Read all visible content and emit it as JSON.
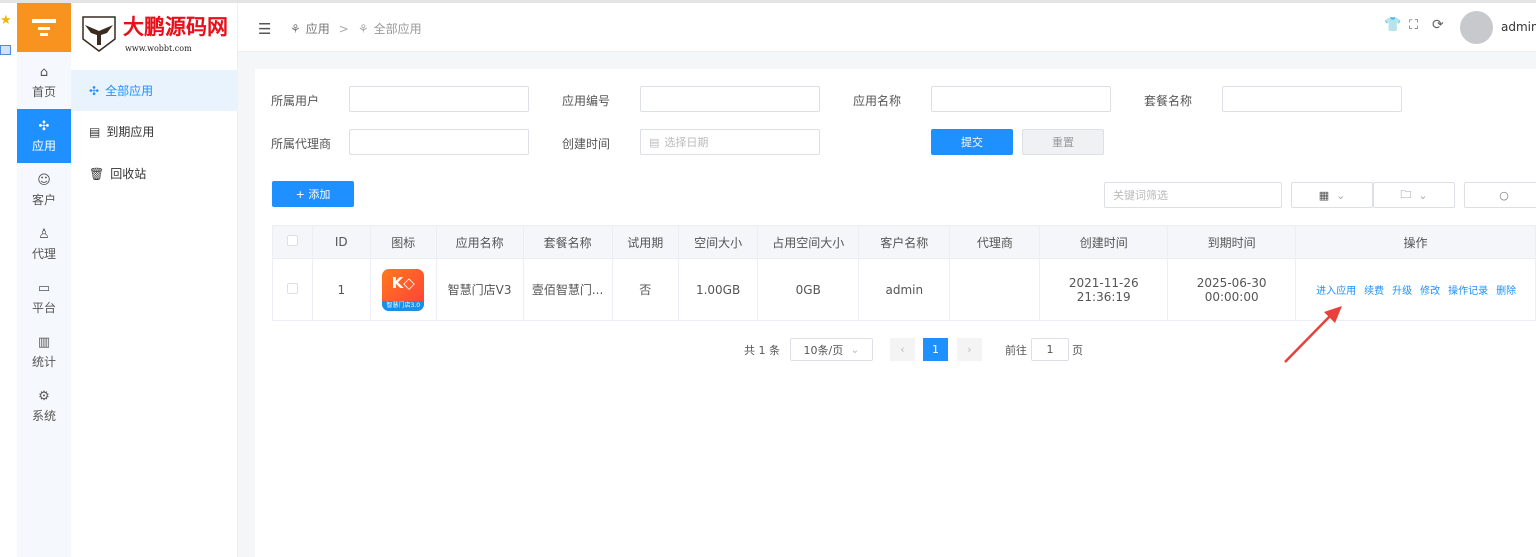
{
  "brand": {
    "name": "大鹏源码网",
    "url": "www.wobbt.com"
  },
  "rail": [
    {
      "label": "首页",
      "icon": "home-icon"
    },
    {
      "label": "应用",
      "icon": "apps-icon",
      "active": true
    },
    {
      "label": "客户",
      "icon": "user-icon"
    },
    {
      "label": "代理",
      "icon": "agent-icon"
    },
    {
      "label": "平台",
      "icon": "monitor-icon"
    },
    {
      "label": "统计",
      "icon": "chart-icon"
    },
    {
      "label": "系统",
      "icon": "gear-icon"
    }
  ],
  "submenu": [
    {
      "label": "全部应用",
      "active": true
    },
    {
      "label": "到期应用"
    },
    {
      "label": "回收站"
    }
  ],
  "breadcrumb": {
    "parent": "应用",
    "sep": ">",
    "current": "全部应用"
  },
  "header": {
    "user": "admin"
  },
  "filters": {
    "owner_user": "所属用户",
    "app_no": "应用编号",
    "app_name": "应用名称",
    "package_name": "套餐名称",
    "agent": "所属代理商",
    "created": "创建时间",
    "date_placeholder": "选择日期",
    "submit": "提交",
    "reset": "重置"
  },
  "toolbar": {
    "add": "+ 添加",
    "keyword_placeholder": "关键词筛选"
  },
  "table": {
    "headers": [
      "ID",
      "图标",
      "应用名称",
      "套餐名称",
      "试用期",
      "空间大小",
      "占用空间大小",
      "客户名称",
      "代理商",
      "创建时间",
      "到期时间",
      "操作"
    ],
    "rows": [
      {
        "id": "1",
        "icon_text": "智慧门店3.0",
        "app_name": "智慧门店V3",
        "package": "壹佰智慧门...",
        "trial": "否",
        "space": "1.00GB",
        "used": "0GB",
        "customer": "admin",
        "agent": "",
        "created": "2021-11-26 21:36:19",
        "expires": "2025-06-30 00:00:00"
      }
    ],
    "actions": [
      "进入应用",
      "续费",
      "升级",
      "修改",
      "操作记录",
      "删除"
    ]
  },
  "pagination": {
    "total": "共 1 条",
    "page_size": "10条/页",
    "current": "1",
    "goto": "前往",
    "goto_value": "1",
    "page_unit": "页"
  },
  "colors": {
    "accent": "#1e90ff",
    "logo_bg": "#f7931e",
    "annotation_arrow": "#e8403a"
  }
}
